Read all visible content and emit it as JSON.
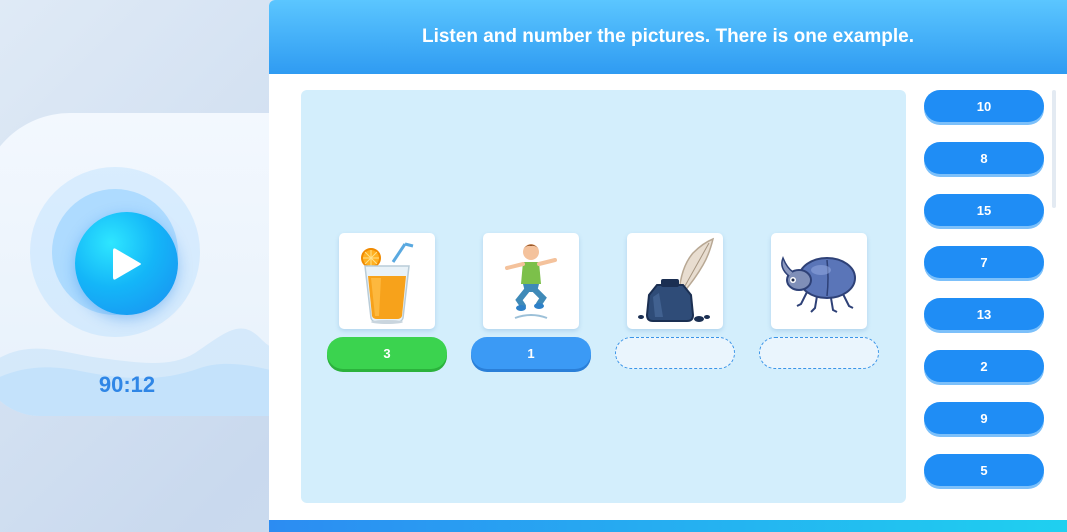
{
  "player": {
    "timer": "90:12",
    "play_icon": "play-icon"
  },
  "header": {
    "instruction": "Listen and number the pictures. There is one example."
  },
  "pictures": [
    {
      "icon": "orange-juice-icon",
      "answer": "3",
      "state": "example"
    },
    {
      "icon": "jumping-boy-icon",
      "answer": "1",
      "state": "filled"
    },
    {
      "icon": "ink-and-quill-icon",
      "answer": "",
      "state": "empty"
    },
    {
      "icon": "beetle-icon",
      "answer": "",
      "state": "empty"
    }
  ],
  "options": [
    "10",
    "8",
    "15",
    "7",
    "13",
    "2",
    "9",
    "5"
  ],
  "colors": {
    "example_green": "#3bd34f",
    "answer_blue": "#3b9af5",
    "option_blue": "#1f8df5",
    "header_blue": "#2f9bf2",
    "work_area": "#d3eefc"
  }
}
